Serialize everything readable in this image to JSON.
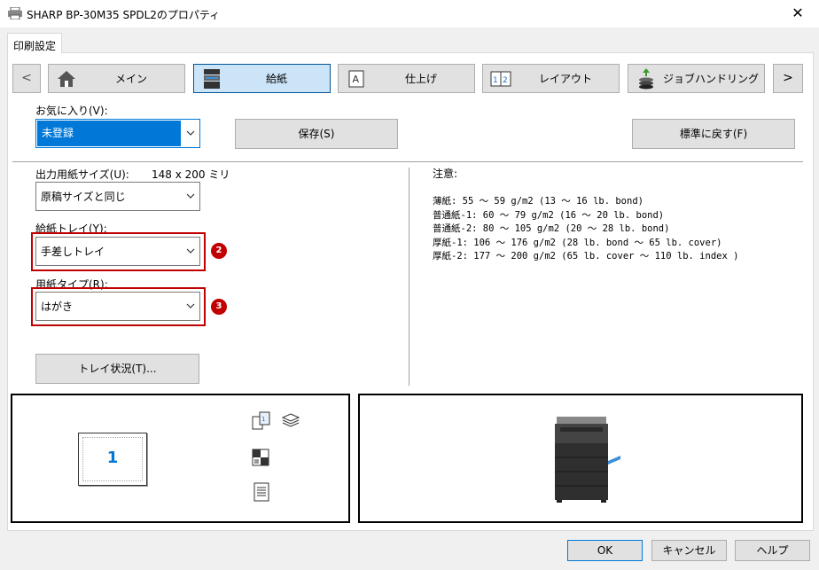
{
  "window": {
    "title": "SHARP BP-30M35 SPDL2のプロパティ",
    "close_label": "✕"
  },
  "tab": {
    "label": "印刷設定"
  },
  "nav": {
    "prev_label": "<",
    "next_label": ">",
    "items": [
      {
        "label": "メイン"
      },
      {
        "label": "給紙"
      },
      {
        "label": "仕上げ"
      },
      {
        "label": "レイアウト"
      },
      {
        "label": "ジョブハンドリング"
      }
    ]
  },
  "favorites": {
    "label": "お気に入り(V):",
    "value": "未登録",
    "save_label": "保存(S)",
    "reset_label": "標準に戻す(F)"
  },
  "output_size": {
    "label": "出力用紙サイズ(U):",
    "dims": "148 x 200 ミリ",
    "value": "原稿サイズと同じ"
  },
  "paper_tray": {
    "label": "給紙トレイ(Y):",
    "value": "手差しトレイ",
    "badge": "2"
  },
  "paper_type": {
    "label": "用紙タイプ(R):",
    "value": "はがき",
    "badge": "3"
  },
  "tray_status_label": "トレイ状況(T)...",
  "notes": {
    "title": "注意:",
    "lines": [
      "薄紙: 55 ～ 59 g/m2 (13 ～ 16 lb. bond)",
      "普通紙-1: 60 ～ 79 g/m2 (16 ～ 20 lb. bond)",
      "普通紙-2: 80 ～ 105 g/m2 (20 ～ 28 lb. bond)",
      "厚紙-1: 106 ～ 176 g/m2 (28 lb. bond ～ 65 lb. cover)",
      "厚紙-2: 177 ～ 200 g/m2 (65 lb. cover ～ 110 lb. index )"
    ]
  },
  "preview": {
    "page_number": "1"
  },
  "footer": {
    "ok_label": "OK",
    "cancel_label": "キャンセル",
    "help_label": "ヘルプ"
  },
  "colors": {
    "accent": "#0078d7",
    "highlight": "#c00000",
    "active_tab": "#cce4f7"
  }
}
